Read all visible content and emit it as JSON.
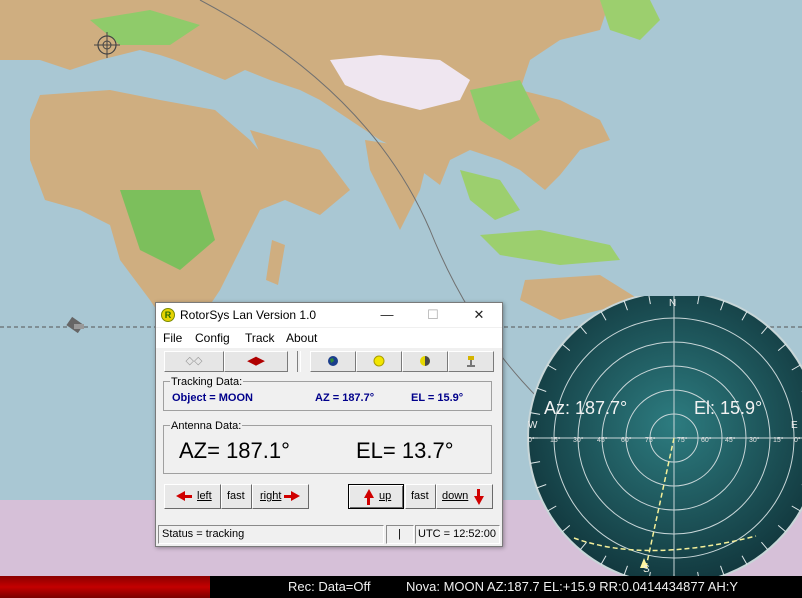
{
  "window": {
    "title": "RotorSys Lan Version 1.0",
    "app_icon_letter": "R",
    "minimize_glyph": "—",
    "maximize_glyph": "☐",
    "close_glyph": "✕"
  },
  "menu": [
    "File",
    "Config",
    "Track",
    "About"
  ],
  "toolbar": {
    "icons": [
      "antenna-dots-icon",
      "left-right-arrows-icon",
      "earth-icon",
      "sun-icon",
      "moon-icon",
      "satellite-icon"
    ]
  },
  "tracking": {
    "label": "Tracking Data:",
    "object": "Object = MOON",
    "az": "AZ = 187.7°",
    "el": "EL = 15.9°"
  },
  "antenna": {
    "label": "Antenna Data:",
    "az": "AZ= 187.1°",
    "el": "EL= 13.7°"
  },
  "controls": {
    "left": "left",
    "fast_left": "fast",
    "right": "right",
    "up": "up",
    "fast_right": "fast",
    "down": "down"
  },
  "status": {
    "text": "Status = tracking",
    "middle": "|",
    "utc": "UTC = 12:52:00"
  },
  "bottombar": {
    "rec": "Rec: Data=Off",
    "nova": "Nova: MOON AZ:187.7 EL:+15.9 RR:0.0414434877 AH:Y"
  },
  "radar": {
    "az": "Az: 187.7°",
    "el": "El: 15.9°",
    "north": "N",
    "east": "E",
    "west": "W",
    "south": "S",
    "elevation_ticks": [
      "0°",
      "15°",
      "30°",
      "45°",
      "60°",
      "75°",
      "75°",
      "60°",
      "45°",
      "30°",
      "15°",
      "0°"
    ]
  },
  "colors": {
    "ocean": "#a9c7d3",
    "land": "#d2b48c",
    "status_red": "#c40000",
    "radar_bg": "#1f5a60"
  }
}
